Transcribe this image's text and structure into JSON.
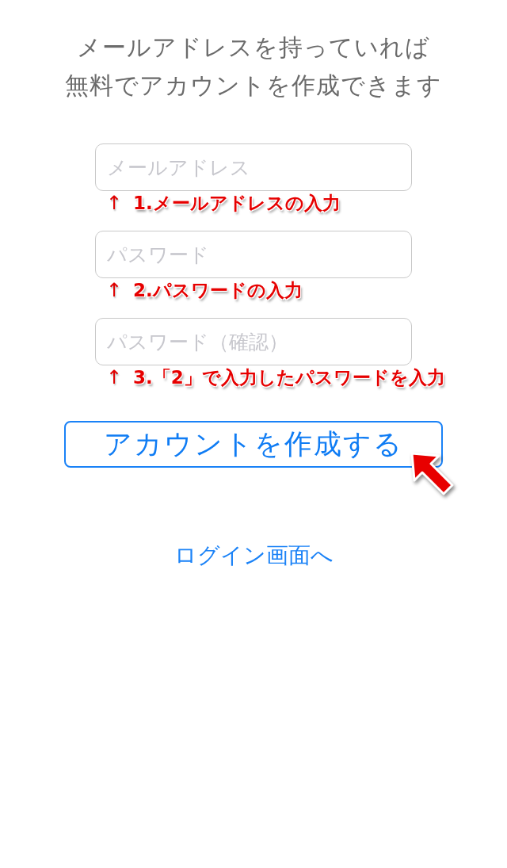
{
  "intro": {
    "lines": [
      "メールアドレスを持っていれば",
      "無料でアカウントを作成できます"
    ]
  },
  "fields": [
    {
      "placeholder": "メールアドレス",
      "note": {
        "arrow": "↑",
        "text": "1.メールアドレスの入力"
      }
    },
    {
      "placeholder": "パスワード",
      "note": {
        "arrow": "↑",
        "text": "2.パスワードの入力"
      }
    },
    {
      "placeholder": "パスワード（確認）",
      "note": {
        "arrow": "↑",
        "text": "3.「2」で入力したパスワードを入力"
      }
    }
  ],
  "create_button": {
    "label": "アカウントを作成する"
  },
  "login_link": {
    "label": "ログイン画面へ"
  }
}
